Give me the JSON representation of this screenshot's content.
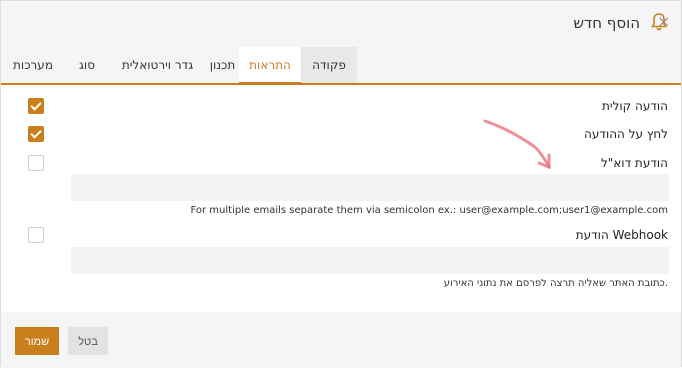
{
  "dialog": {
    "title": "הוסף חדש",
    "close_label": "×"
  },
  "tabs": [
    {
      "label": "פקודה"
    },
    {
      "label": "התראות"
    },
    {
      "label": "תכנון"
    },
    {
      "label": "גדר וירטואלית"
    },
    {
      "label": "סוג"
    },
    {
      "label": "מערכות"
    }
  ],
  "form": {
    "voice": {
      "label": "הודעה קולית",
      "checked": true
    },
    "push": {
      "label": "לחץ על ההודעה",
      "checked": true
    },
    "email": {
      "label": "הודעת דוא\"ל",
      "checked": false,
      "value": "",
      "hint": "For multiple emails separate them via semicolon ex.: user@example.com;user1@example.com"
    },
    "webhook": {
      "label": "הודעת Webhook",
      "checked": false,
      "value": "",
      "hint": "כתובת האתר שאליה תרצה לפרסם את נתוני האירוע."
    }
  },
  "footer": {
    "save_label": "שמור",
    "cancel_label": "בטל"
  },
  "colors": {
    "accent": "#c97f1c",
    "annotation": "#e86a78"
  },
  "icons": {
    "title": "bell-icon",
    "close": "close-icon",
    "checkbox_checked": "checkmark-icon",
    "annotation": "arrow-annotation"
  }
}
